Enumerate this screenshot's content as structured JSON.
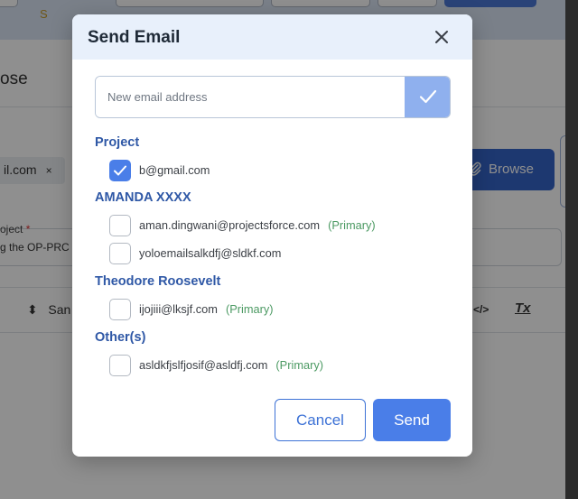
{
  "background": {
    "compose_label": "ose",
    "chip_text": "il.com",
    "chip_close": "×",
    "browse_label": "Browse",
    "project_label": "oject",
    "required_mark": "*",
    "project_value": "g the OP-PRC",
    "font_label": "San",
    "toolbar_code": "</>",
    "toolbar_clear": "Tx"
  },
  "modal": {
    "title": "Send Email",
    "email_input": {
      "value": "",
      "placeholder": "New email address"
    },
    "groups": [
      {
        "label": "Project",
        "contacts": [
          {
            "email": "b@gmail.com",
            "primary": "",
            "checked": true
          }
        ]
      },
      {
        "label": "AMANDA XXXX",
        "contacts": [
          {
            "email": "aman.dingwani@projectsforce.com",
            "primary": "(Primary)",
            "checked": false
          },
          {
            "email": "yoloemailsalkdfj@sldkf.com",
            "primary": "",
            "checked": false
          }
        ]
      },
      {
        "label": "Theodore Roosevelt",
        "contacts": [
          {
            "email": "ijojiii@lksjf.com",
            "primary": "(Primary)",
            "checked": false
          }
        ]
      },
      {
        "label": "Other(s)",
        "contacts": [
          {
            "email": "asldkfjslfjosif@asldfj.com",
            "primary": "(Primary)",
            "checked": false
          }
        ]
      }
    ],
    "cancel_label": "Cancel",
    "send_label": "Send"
  },
  "colors": {
    "accent": "#4a7ee8",
    "group_label": "#2f58a6",
    "primary_tag": "#4c9a63",
    "header_bg": "#e8f0fb"
  },
  "icons": {
    "close": "close-icon",
    "add": "check-icon",
    "checkbox": "check-icon"
  }
}
